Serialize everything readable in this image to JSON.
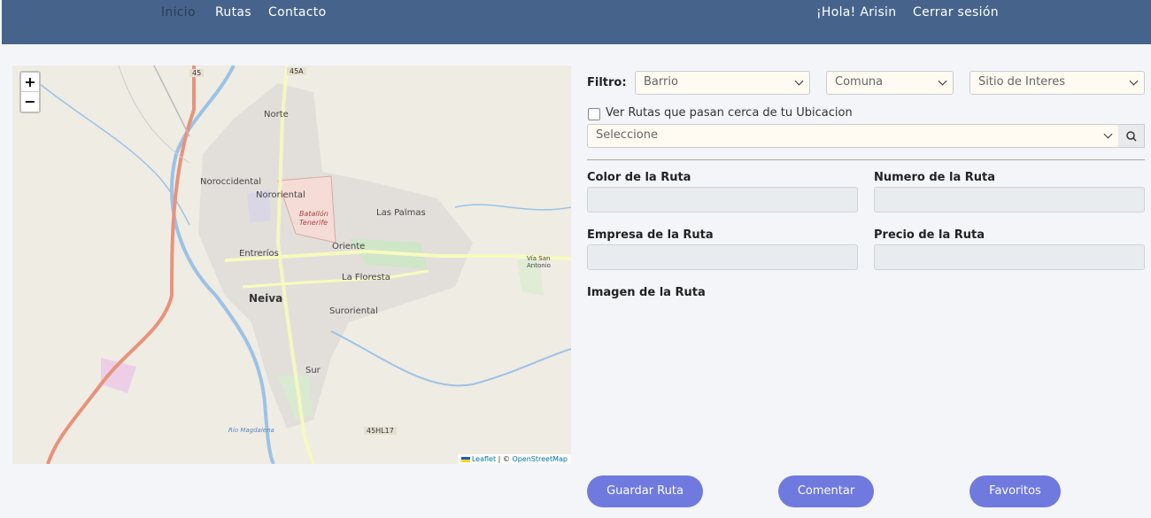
{
  "nav": {
    "inicio": "Inicio",
    "rutas": "Rutas",
    "contacto": "Contacto",
    "greeting": "¡Hola! Arisin",
    "logout": "Cerrar sesión"
  },
  "map": {
    "zoom_in": "+",
    "zoom_out": "−",
    "attribution_leaflet": "Leaflet",
    "attribution_sep": " | © ",
    "attribution_osm": "OpenStreetMap",
    "labels": {
      "norte": "Norte",
      "noroccidental": "Noroccidental",
      "nororiental": "Nororiental",
      "batallon": "Batallón",
      "tenerife": "Tenerife",
      "las_palmas": "Las Palmas",
      "oriente": "Oriente",
      "entrerios": "Entreríos",
      "la_floresta": "La Floresta",
      "neiva": "Neiva",
      "suroriental": "Suroriental",
      "sur": "Sur",
      "rio_magdalena": "Río Magdalena",
      "via_san_antonio": "Vía San Antonio",
      "r45a": "45A",
      "r45": "45",
      "r45hl17": "45HL17"
    }
  },
  "filters": {
    "label": "Filtro:",
    "barrio": "Barrio",
    "comuna": "Comuna",
    "sitio": "Sitio de Interes",
    "nearby_label": "Ver Rutas que pasan cerca de tu Ubicacion",
    "route_select": "Seleccione"
  },
  "details": {
    "color_label": "Color de la Ruta",
    "numero_label": "Numero de la Ruta",
    "empresa_label": "Empresa de la Ruta",
    "precio_label": "Precio de la Ruta",
    "imagen_label": "Imagen de la Ruta"
  },
  "actions": {
    "guardar": "Guardar Ruta",
    "comentar": "Comentar",
    "favoritos": "Favoritos"
  },
  "colors": {
    "header": "#46648b",
    "button": "#6f79de",
    "map_bg": "#efece4"
  }
}
